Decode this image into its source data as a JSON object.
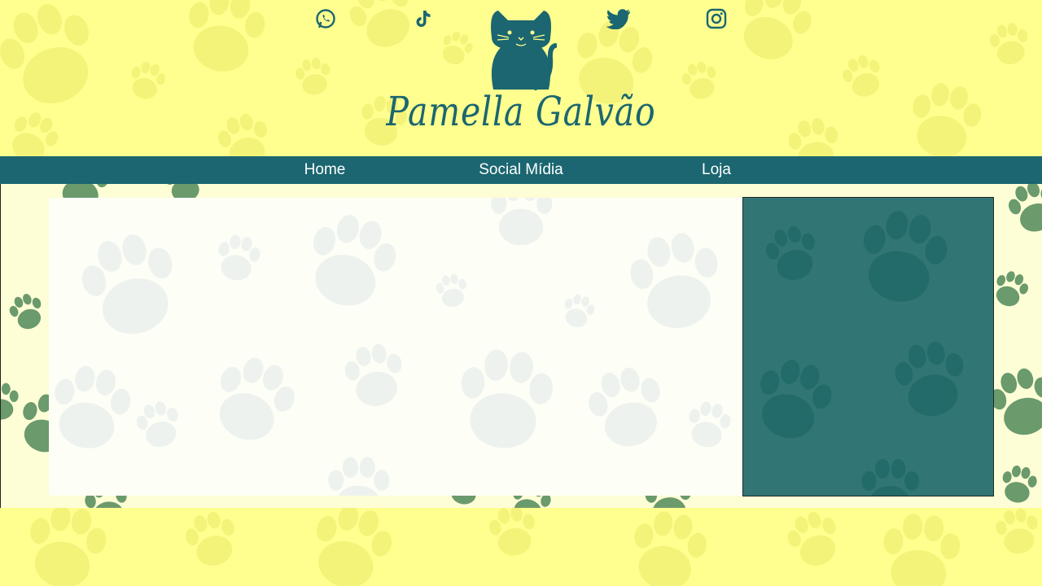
{
  "header": {
    "social_icons": [
      "whatsapp-icon",
      "tiktok-icon",
      "cat-logo-icon",
      "twitter-icon",
      "instagram-icon"
    ],
    "title": "Pamella Galvão"
  },
  "nav": {
    "items": [
      {
        "label": "Home"
      },
      {
        "label": "Social Mídia"
      },
      {
        "label": "Loja"
      }
    ]
  },
  "colors": {
    "brand_teal": "#1b6670",
    "header_yellow": "#ffff8f",
    "content_cream": "#fdfdd6",
    "side_panel": "#317674",
    "main_panel": "#fdfff6"
  }
}
